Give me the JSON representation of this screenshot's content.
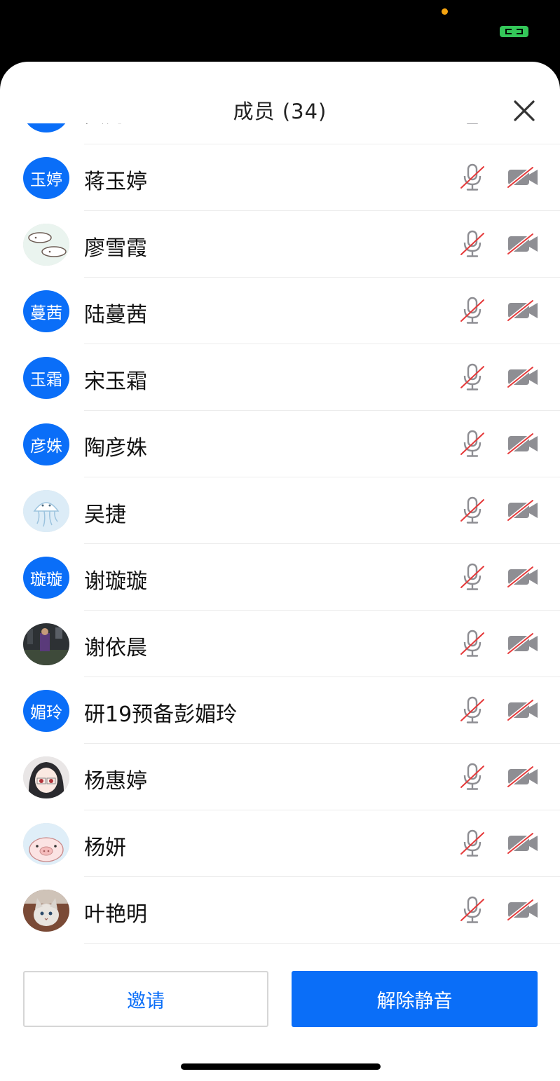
{
  "header": {
    "title": "成员 (34)"
  },
  "colors": {
    "accent": "#0a6ef8",
    "muted_red": "#e5393a",
    "icon_gray": "#8e8e93"
  },
  "members": [
    {
      "name": "黄秀正",
      "avatar_text": "秀正",
      "avatar": "text"
    },
    {
      "name": "蒋玉婷",
      "avatar_text": "玉婷",
      "avatar": "text"
    },
    {
      "name": "廖雪霞",
      "avatar_text": "",
      "avatar": "clouds"
    },
    {
      "name": "陆蔓茜",
      "avatar_text": "蔓茜",
      "avatar": "text"
    },
    {
      "name": "宋玉霜",
      "avatar_text": "玉霜",
      "avatar": "text"
    },
    {
      "name": "陶彦姝",
      "avatar_text": "彦姝",
      "avatar": "text"
    },
    {
      "name": "吴捷",
      "avatar_text": "",
      "avatar": "jellyfish"
    },
    {
      "name": "谢璇璇",
      "avatar_text": "璇璇",
      "avatar": "text"
    },
    {
      "name": "谢依晨",
      "avatar_text": "",
      "avatar": "game"
    },
    {
      "name": "研19预备彭媚玲",
      "avatar_text": "媚玲",
      "avatar": "text"
    },
    {
      "name": "杨惠婷",
      "avatar_text": "",
      "avatar": "anime"
    },
    {
      "name": "杨妍",
      "avatar_text": "",
      "avatar": "pig"
    },
    {
      "name": "叶艳明",
      "avatar_text": "",
      "avatar": "cat"
    }
  ],
  "footer": {
    "invite_label": "邀请",
    "unmute_label": "解除静音"
  }
}
